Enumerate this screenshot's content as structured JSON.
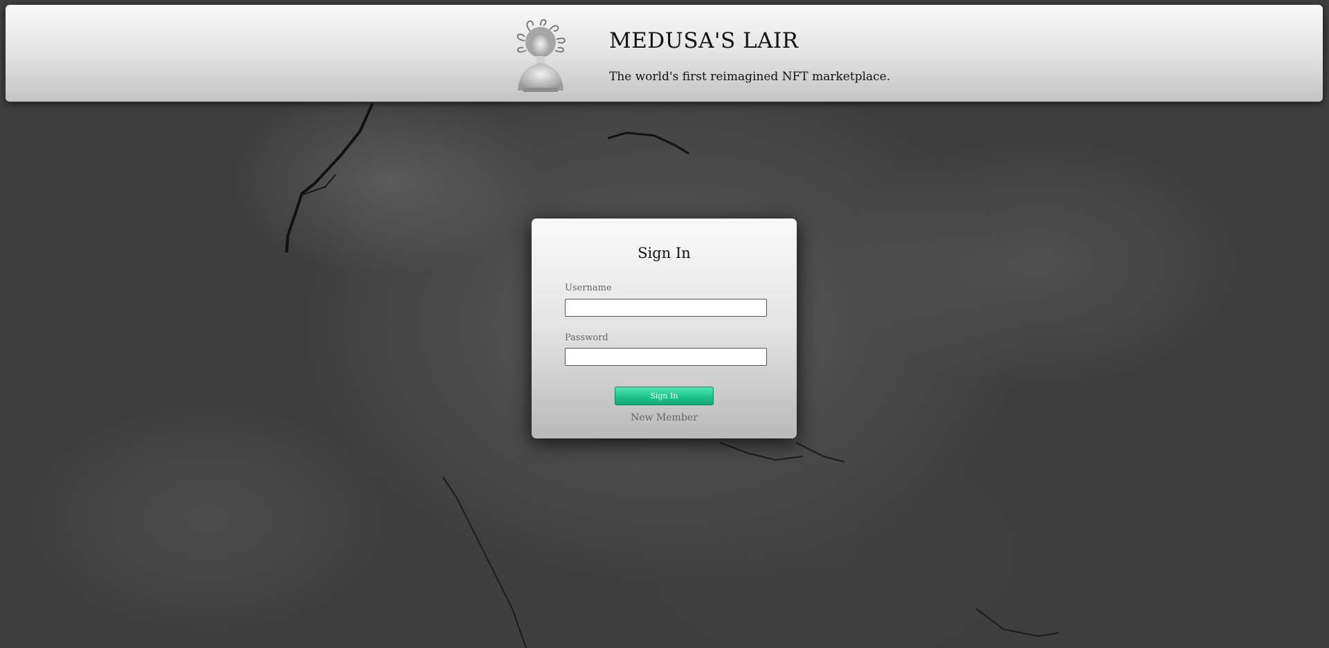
{
  "header": {
    "logo_icon": "medusa-bust-icon",
    "title": "MEDUSA'S LAIR",
    "tagline": "The world's first reimagined NFT marketplace."
  },
  "signin": {
    "title": "Sign In",
    "username_label": "Username",
    "username_value": "",
    "password_label": "Password",
    "password_value": "",
    "submit_label": "Sign In",
    "new_member_label": "New Member"
  },
  "colors": {
    "accent": "#22c896",
    "background": "#4a4a4a"
  }
}
